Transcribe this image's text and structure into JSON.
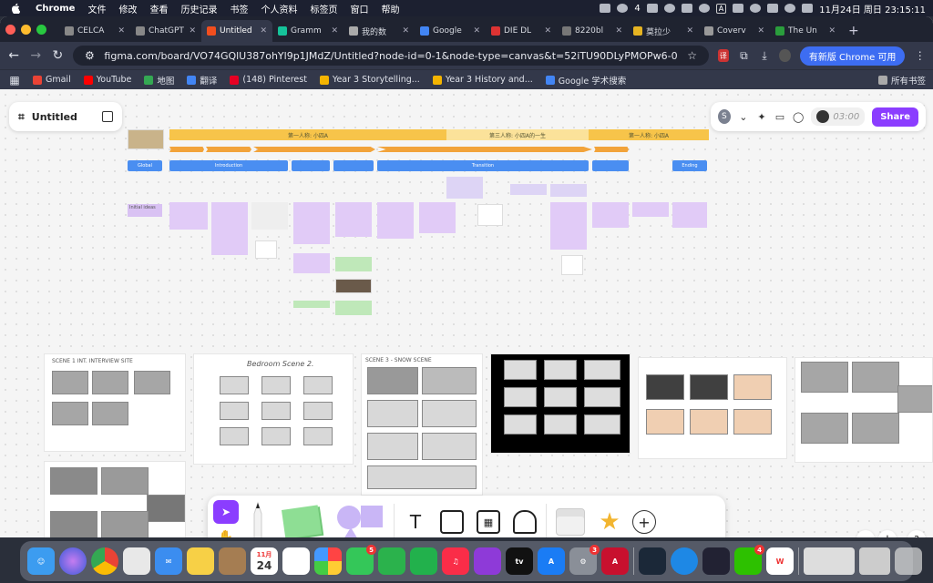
{
  "menubar": {
    "app": "Chrome",
    "items": [
      "文件",
      "修改",
      "查看",
      "历史记录",
      "书签",
      "个人资料",
      "标签页",
      "窗口",
      "帮助"
    ],
    "wechat_count": "4",
    "ime": "A",
    "clock": "11月24日 周日  23:15:11"
  },
  "tabs": [
    {
      "title": "CELCA",
      "color": "#888"
    },
    {
      "title": "ChatGPT",
      "color": "#888"
    },
    {
      "title": "Untitled",
      "color": "#f24e1e",
      "active": true
    },
    {
      "title": "Gramm",
      "color": "#15c39a"
    },
    {
      "title": "我的数",
      "color": "#aaa"
    },
    {
      "title": "Google",
      "color": "#4285f4"
    },
    {
      "title": "DIE DL",
      "color": "#d33"
    },
    {
      "title": "8220bl",
      "color": "#777"
    },
    {
      "title": "莫拉少",
      "color": "#e6b422"
    },
    {
      "title": "Coverv",
      "color": "#999"
    },
    {
      "title": "The Un",
      "color": "#2a9d3c"
    }
  ],
  "address": {
    "url": "figma.com/board/VO74GQlU387ohYl9p1JMdZ/Untitled?node-id=0-1&node-type=canvas&t=52iTU90DLyPMOPw6-0",
    "update_label": "有新版 Chrome 可用"
  },
  "bookmarks": [
    {
      "label": "Gmail",
      "color": "#ea4335"
    },
    {
      "label": "YouTube",
      "color": "#ff0000"
    },
    {
      "label": "地图",
      "color": "#34a853"
    },
    {
      "label": "翻译",
      "color": "#4285f4"
    },
    {
      "label": "(148) Pinterest",
      "color": "#e60023"
    },
    {
      "label": "Year 3 Storytelling...",
      "color": "#f4b400"
    },
    {
      "label": "Year 3 History and...",
      "color": "#f4b400"
    },
    {
      "label": "Google 学术搜索",
      "color": "#4285f4"
    }
  ],
  "bookmarks_all": "所有书签",
  "figma": {
    "file_name": "Untitled",
    "avatar_initial": "S",
    "timer": "03:00",
    "share_label": "Share"
  },
  "timeline": {
    "yellow1": "第一人称: 小四A",
    "yellow2": "第三人称: 小四A的一生",
    "yellow3": "第一人称: 小四A",
    "blue1": "Global",
    "blue2": "Introduction",
    "blue3": "Transition",
    "blue4": "Ending",
    "sticky_first": "Initial ideas"
  },
  "boards": {
    "b1": "SCENE 1  INT. INTERVIEW SITE",
    "b2": "Bedroom Scene 2.",
    "b3": "SCENE 3 - SNOW SCENE"
  },
  "dock": {
    "calendar_month": "11月",
    "calendar_day": "24",
    "mail_badge": "5",
    "prefs_badge": "3",
    "wechat_badge": "4"
  }
}
